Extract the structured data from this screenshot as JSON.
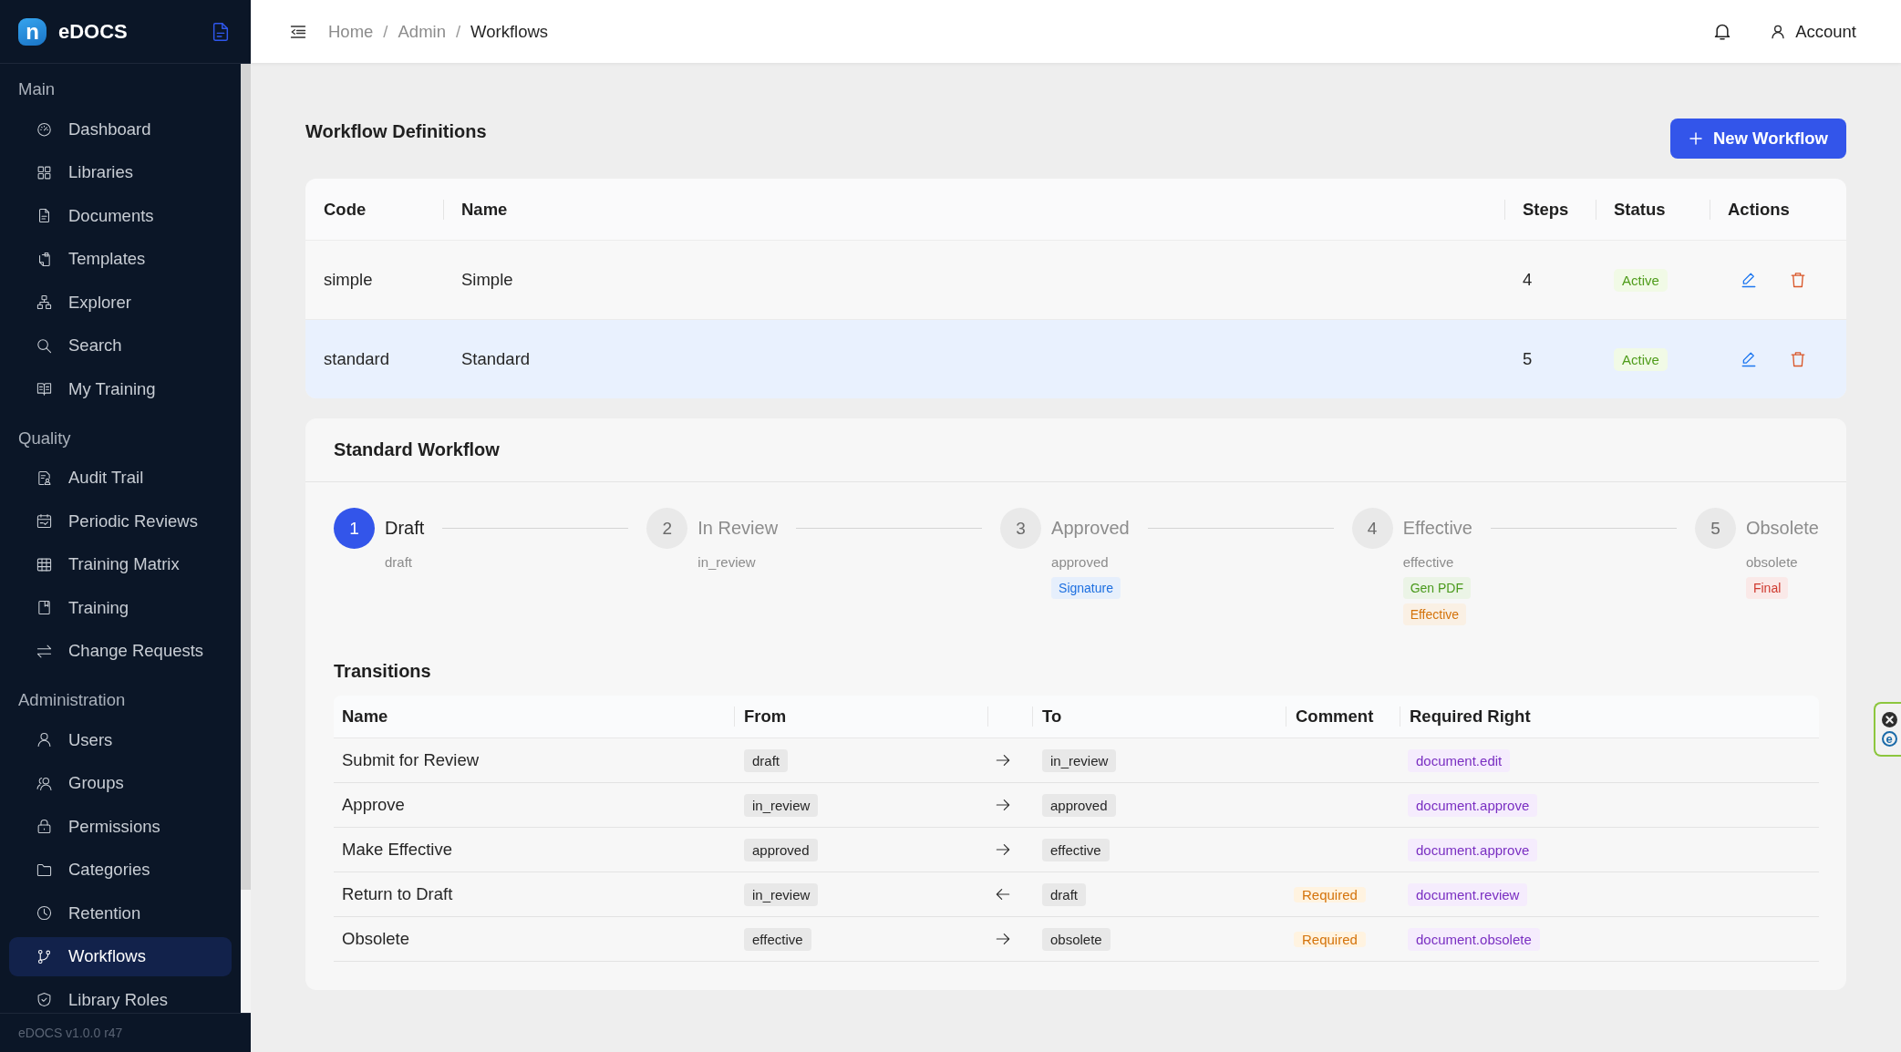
{
  "sidebar": {
    "logo": {
      "mark": "n",
      "name": "eDOCS"
    },
    "sections": [
      {
        "title": "Main",
        "items": [
          {
            "label": "Dashboard",
            "selected": false
          },
          {
            "label": "Libraries",
            "selected": false
          },
          {
            "label": "Documents",
            "selected": false
          },
          {
            "label": "Templates",
            "selected": false
          },
          {
            "label": "Explorer",
            "selected": false
          },
          {
            "label": "Search",
            "selected": false
          },
          {
            "label": "My Training",
            "selected": false
          }
        ]
      },
      {
        "title": "Quality",
        "items": [
          {
            "label": "Audit Trail",
            "selected": false
          },
          {
            "label": "Periodic Reviews",
            "selected": false
          },
          {
            "label": "Training Matrix",
            "selected": false
          },
          {
            "label": "Training",
            "selected": false
          },
          {
            "label": "Change Requests",
            "selected": false
          }
        ]
      },
      {
        "title": "Administration",
        "items": [
          {
            "label": "Users",
            "selected": false
          },
          {
            "label": "Groups",
            "selected": false
          },
          {
            "label": "Permissions",
            "selected": false
          },
          {
            "label": "Categories",
            "selected": false
          },
          {
            "label": "Retention",
            "selected": false
          },
          {
            "label": "Workflows",
            "selected": true
          },
          {
            "label": "Library Roles",
            "selected": false
          }
        ]
      }
    ],
    "version": "eDOCS v1.0.0 r47"
  },
  "header": {
    "breadcrumb": [
      {
        "label": "Home",
        "current": false,
        "separator": "/"
      },
      {
        "label": "Admin",
        "current": false,
        "separator": "/"
      },
      {
        "label": "Workflows",
        "current": true
      }
    ],
    "account": "Account"
  },
  "definitions": {
    "title": "Workflow Definitions",
    "new_button": "New Workflow",
    "columns": [
      "Code",
      "Name",
      "Steps",
      "Status",
      "Actions"
    ],
    "rows": [
      {
        "code": "simple",
        "name": "Simple",
        "steps": "4",
        "status": "Active",
        "selected": false
      },
      {
        "code": "standard",
        "name": "Standard",
        "steps": "5",
        "status": "Active",
        "selected": true
      }
    ]
  },
  "detail": {
    "title": "Standard Workflow",
    "steps": [
      {
        "number": "1",
        "title": "Draft",
        "key": "draft",
        "active": true
      },
      {
        "number": "2",
        "title": "In Review",
        "key": "in_review",
        "active": false
      },
      {
        "number": "3",
        "title": "Approved",
        "key": "approved",
        "active": false,
        "tags": [
          {
            "label": "Signature",
            "color": "#1d6fe0"
          }
        ]
      },
      {
        "number": "4",
        "title": "Effective",
        "key": "effective",
        "active": false,
        "tags": [
          {
            "label": "Gen PDF",
            "color": "#4a9a1c"
          },
          {
            "label": "Effective",
            "color": "#d4730b"
          }
        ]
      },
      {
        "number": "5",
        "title": "Obsolete",
        "key": "obsolete",
        "active": false,
        "tags": [
          {
            "label": "Final",
            "color": "#cf3a2f"
          }
        ]
      }
    ],
    "transitions": {
      "title": "Transitions",
      "columns": [
        "Name",
        "From",
        "To",
        "Comment",
        "Required Right"
      ],
      "rows": [
        {
          "name": "Submit for Review",
          "from": "draft",
          "reverse": false,
          "to": "in_review",
          "right": "document.edit"
        },
        {
          "name": "Approve",
          "from": "in_review",
          "reverse": false,
          "to": "approved",
          "right": "document.approve"
        },
        {
          "name": "Make Effective",
          "from": "approved",
          "reverse": false,
          "to": "effective",
          "right": "document.approve"
        },
        {
          "name": "Return to Draft",
          "from": "in_review",
          "reverse": true,
          "to": "draft",
          "comment": "Required",
          "right": "document.review"
        },
        {
          "name": "Obsolete",
          "from": "effective",
          "reverse": false,
          "to": "obsolete",
          "comment": "Required",
          "right": "document.obsolete"
        }
      ]
    }
  },
  "extension_widget": {
    "badge": "e"
  }
}
